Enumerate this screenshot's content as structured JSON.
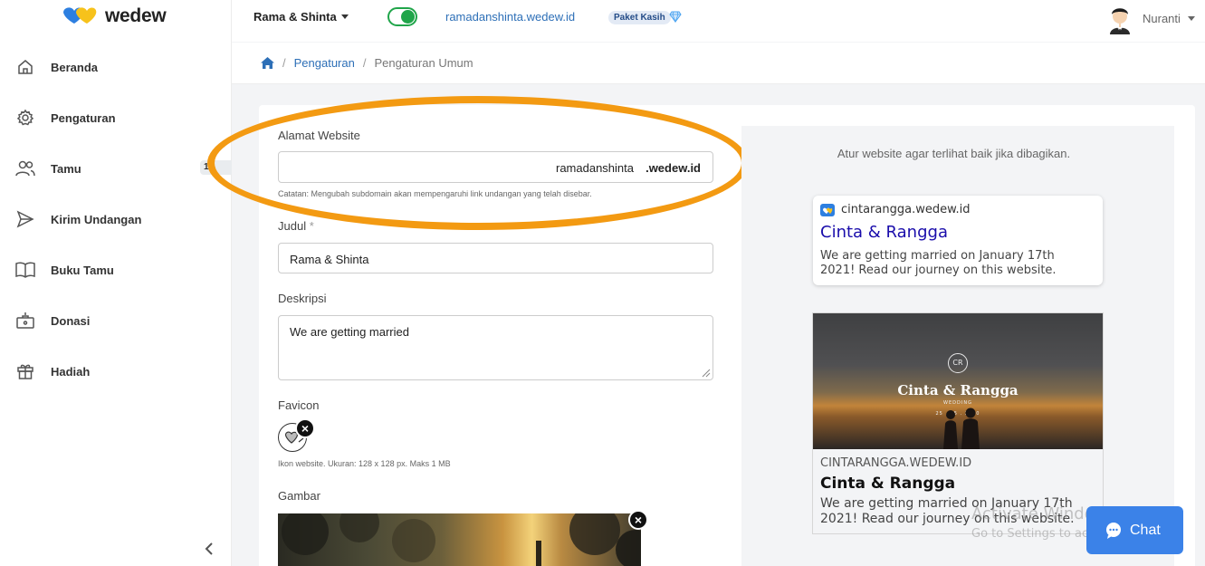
{
  "brand": {
    "name": "wedew"
  },
  "sidebar": {
    "items": [
      {
        "label": "Beranda",
        "icon": "home-icon"
      },
      {
        "label": "Pengaturan",
        "icon": "gear-icon"
      },
      {
        "label": "Tamu",
        "icon": "users-icon",
        "badge": "1"
      },
      {
        "label": "Kirim Undangan",
        "icon": "send-icon"
      },
      {
        "label": "Buku Tamu",
        "icon": "book-icon"
      },
      {
        "label": "Donasi",
        "icon": "donation-box-icon"
      },
      {
        "label": "Hadiah",
        "icon": "gift-icon"
      }
    ],
    "collapse_icon": "chevron-left-icon"
  },
  "topbar": {
    "event": "Rama & Shinta",
    "site_url": "ramadanshinta.wedew.id",
    "package": "Paket Kasih",
    "user": "Nuranti"
  },
  "breadcrumb": {
    "home_icon": "home-icon",
    "link": "Pengaturan",
    "current": "Pengaturan Umum"
  },
  "form": {
    "website_label": "Alamat Website",
    "subdomain_value": "ramadanshinta",
    "domain_suffix": ".wedew.id",
    "website_note": "Catatan: Mengubah subdomain akan mempengaruhi link undangan yang telah disebar.",
    "title_label": "Judul",
    "title_required": "*",
    "title_value": "Rama & Shinta",
    "desc_label": "Deskripsi",
    "desc_value": "We are getting married",
    "favicon_label": "Favicon",
    "favicon_hint": "Ikon website. Ukuran: 128 x 128 px. Maks 1 MB",
    "image_label": "Gambar"
  },
  "preview": {
    "note": "Atur website agar terlihat baik jika dibagikan.",
    "search": {
      "domain": "cintarangga.wedew.id",
      "title": "Cinta & Rangga",
      "description": "We are getting married on January 17th 2021! Read our journey on this website."
    },
    "social": {
      "image_monogram": "CR",
      "image_title": "Cinta & Rangga",
      "image_subtitle": "WEDDING",
      "image_date": "25 . 05 . 2020",
      "domain": "CINTARANGGA.WEDEW.ID",
      "title": "Cinta & Rangga",
      "description": "We are getting married on January 17th 2021! Read our journey on this website."
    }
  },
  "chat": {
    "label": "Chat"
  },
  "watermark": {
    "line1": "Activate Windows",
    "line2": "Go to Settings to activate Windows."
  },
  "colors": {
    "accent": "#2d6fb7",
    "highlight": "#f39a12",
    "toggle": "#20a54a",
    "chat": "#3b82e8"
  }
}
